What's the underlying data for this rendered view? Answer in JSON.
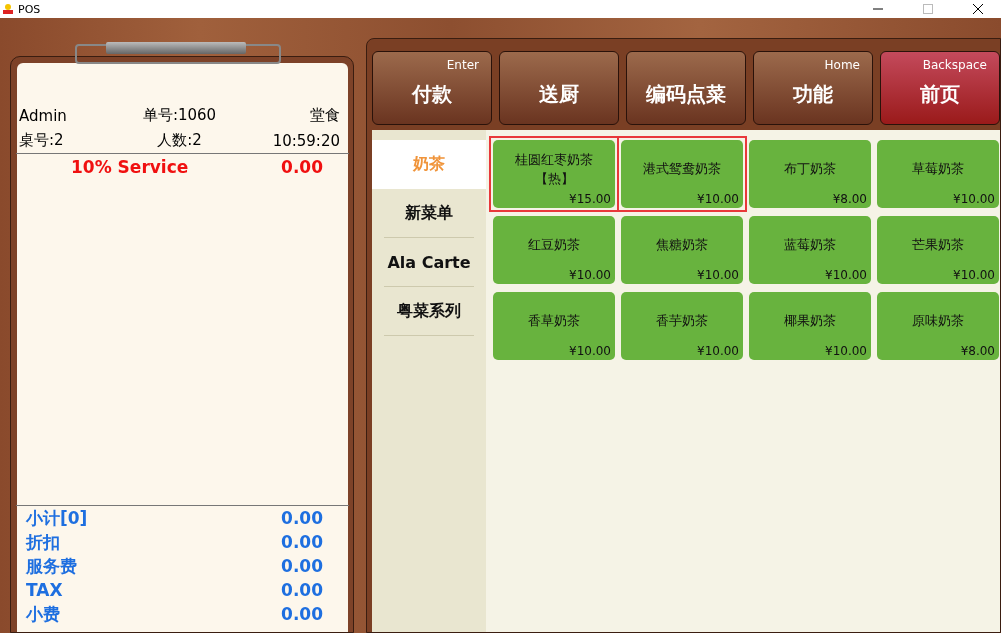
{
  "window": {
    "title": "POS"
  },
  "order": {
    "user": "Admin",
    "order_no": "单号:1060",
    "mode": "堂食",
    "table": "桌号:2",
    "guests": "人数:2",
    "time": "10:59:20"
  },
  "service": {
    "label": "10% Service",
    "amount": "0.00"
  },
  "totals": [
    {
      "label": "小计[0]",
      "amount": "0.00"
    },
    {
      "label": "折扣",
      "amount": "0.00"
    },
    {
      "label": "服务费",
      "amount": "0.00"
    },
    {
      "label": "TAX",
      "amount": "0.00"
    },
    {
      "label": "小费",
      "amount": "0.00"
    }
  ],
  "actions": [
    {
      "label": "付款",
      "shortcut": "Enter",
      "kind": "normal"
    },
    {
      "label": "送厨",
      "kind": "normal"
    },
    {
      "label": "编码点菜",
      "kind": "normal"
    },
    {
      "label": "功能",
      "shortcut": "Home",
      "kind": "normal"
    },
    {
      "label": "前页",
      "shortcut": "Backspace",
      "kind": "danger"
    }
  ],
  "categories": [
    {
      "label": "奶茶",
      "selected": true
    },
    {
      "label": "新菜单",
      "selected": false
    },
    {
      "label": "Ala Carte",
      "selected": false
    },
    {
      "label": "粤菜系列",
      "selected": false
    }
  ],
  "items": [
    {
      "name": "桂圆红枣奶茶【热】",
      "price": "¥15.00",
      "highlighted": true
    },
    {
      "name": "港式鸳鸯奶茶",
      "price": "¥10.00",
      "highlighted": true
    },
    {
      "name": "布丁奶茶",
      "price": "¥8.00",
      "highlighted": false
    },
    {
      "name": "草莓奶茶",
      "price": "¥10.00",
      "highlighted": false
    },
    {
      "name": "红豆奶茶",
      "price": "¥10.00",
      "highlighted": false
    },
    {
      "name": "焦糖奶茶",
      "price": "¥10.00",
      "highlighted": false
    },
    {
      "name": "蓝莓奶茶",
      "price": "¥10.00",
      "highlighted": false
    },
    {
      "name": "芒果奶茶",
      "price": "¥10.00",
      "highlighted": false
    },
    {
      "name": "香草奶茶",
      "price": "¥10.00",
      "highlighted": false
    },
    {
      "name": "香芋奶茶",
      "price": "¥10.00",
      "highlighted": false
    },
    {
      "name": "椰果奶茶",
      "price": "¥10.00",
      "highlighted": false
    },
    {
      "name": "原味奶茶",
      "price": "¥8.00",
      "highlighted": false
    }
  ]
}
